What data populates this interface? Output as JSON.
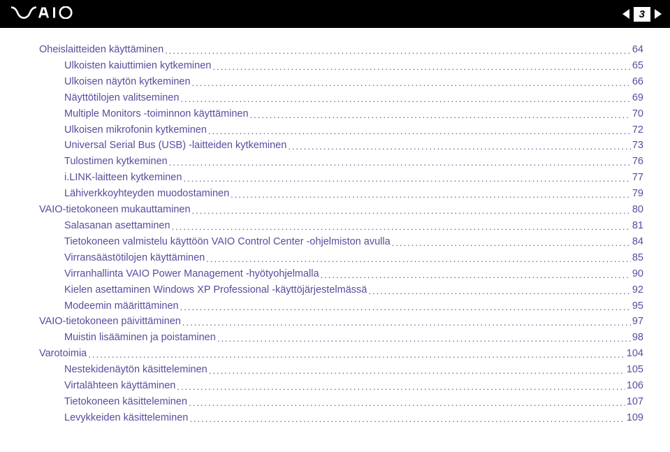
{
  "header": {
    "logo_alt": "VAIO",
    "page_number": "3"
  },
  "toc": [
    {
      "indent": 1,
      "title": "Oheislaitteiden käyttäminen",
      "page": "64"
    },
    {
      "indent": 2,
      "title": "Ulkoisten kaiuttimien kytkeminen",
      "page": "65"
    },
    {
      "indent": 2,
      "title": "Ulkoisen näytön kytkeminen",
      "page": "66"
    },
    {
      "indent": 2,
      "title": "Näyttötilojen valitseminen",
      "page": "69"
    },
    {
      "indent": 2,
      "title": "Multiple Monitors -toiminnon käyttäminen",
      "page": "70"
    },
    {
      "indent": 2,
      "title": "Ulkoisen mikrofonin kytkeminen",
      "page": "72"
    },
    {
      "indent": 2,
      "title": "Universal Serial Bus (USB) -laitteiden kytkeminen",
      "page": "73"
    },
    {
      "indent": 2,
      "title": "Tulostimen kytkeminen",
      "page": "76"
    },
    {
      "indent": 2,
      "title": "i.LINK-laitteen kytkeminen",
      "page": "77"
    },
    {
      "indent": 2,
      "title": "Lähiverkkoyhteyden muodostaminen",
      "page": "79"
    },
    {
      "indent": 1,
      "title": "VAIO-tietokoneen mukauttaminen",
      "page": "80"
    },
    {
      "indent": 2,
      "title": "Salasanan asettaminen",
      "page": "81"
    },
    {
      "indent": 2,
      "title": "Tietokoneen valmistelu käyttöön VAIO Control Center -ohjelmiston avulla",
      "page": "84"
    },
    {
      "indent": 2,
      "title": "Virransäästötilojen käyttäminen",
      "page": "85"
    },
    {
      "indent": 2,
      "title": "Virranhallinta VAIO Power Management -hyötyohjelmalla",
      "page": "90"
    },
    {
      "indent": 2,
      "title": "Kielen asettaminen Windows XP Professional -käyttöjärjestelmässä",
      "page": "92"
    },
    {
      "indent": 2,
      "title": "Modeemin määrittäminen",
      "page": "95"
    },
    {
      "indent": 1,
      "title": "VAIO-tietokoneen päivittäminen",
      "page": "97"
    },
    {
      "indent": 2,
      "title": "Muistin lisääminen ja poistaminen",
      "page": "98"
    },
    {
      "indent": 1,
      "title": "Varotoimia",
      "page": "104"
    },
    {
      "indent": 2,
      "title": "Nestekidenäytön käsitteleminen",
      "page": "105"
    },
    {
      "indent": 2,
      "title": "Virtalähteen käyttäminen",
      "page": "106"
    },
    {
      "indent": 2,
      "title": "Tietokoneen käsitteleminen",
      "page": "107"
    },
    {
      "indent": 2,
      "title": "Levykkeiden käsitteleminen",
      "page": "109"
    }
  ]
}
